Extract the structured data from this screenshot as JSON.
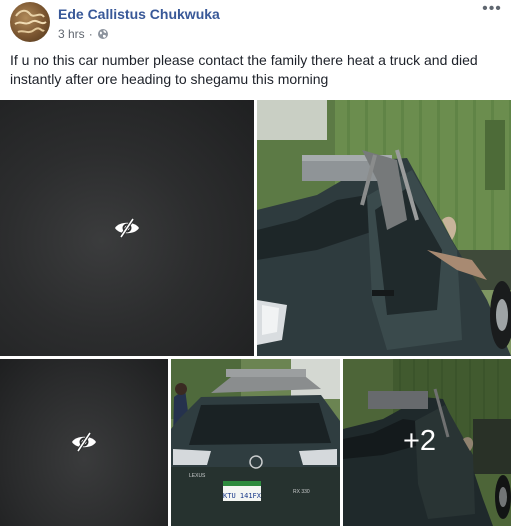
{
  "post": {
    "author": "Ede Callistus Chukwuka",
    "timestamp": "3 hrs",
    "separator": "·",
    "privacy_icon": "globe-icon",
    "more_icon": "more-horizontal-icon",
    "more_label": "•••",
    "text": "If u no this car number please contact the family there heat a truck and died instantly after ore heading to shegamu this morning"
  },
  "photos": {
    "hidden_icon": "eye-slash-icon",
    "extra_count": "+2",
    "plate": "KTU 141FX",
    "brand": "LEXUS",
    "model": "RX 330"
  },
  "colors": {
    "author_link": "#385898",
    "text": "#1d2129",
    "meta": "#616770"
  }
}
